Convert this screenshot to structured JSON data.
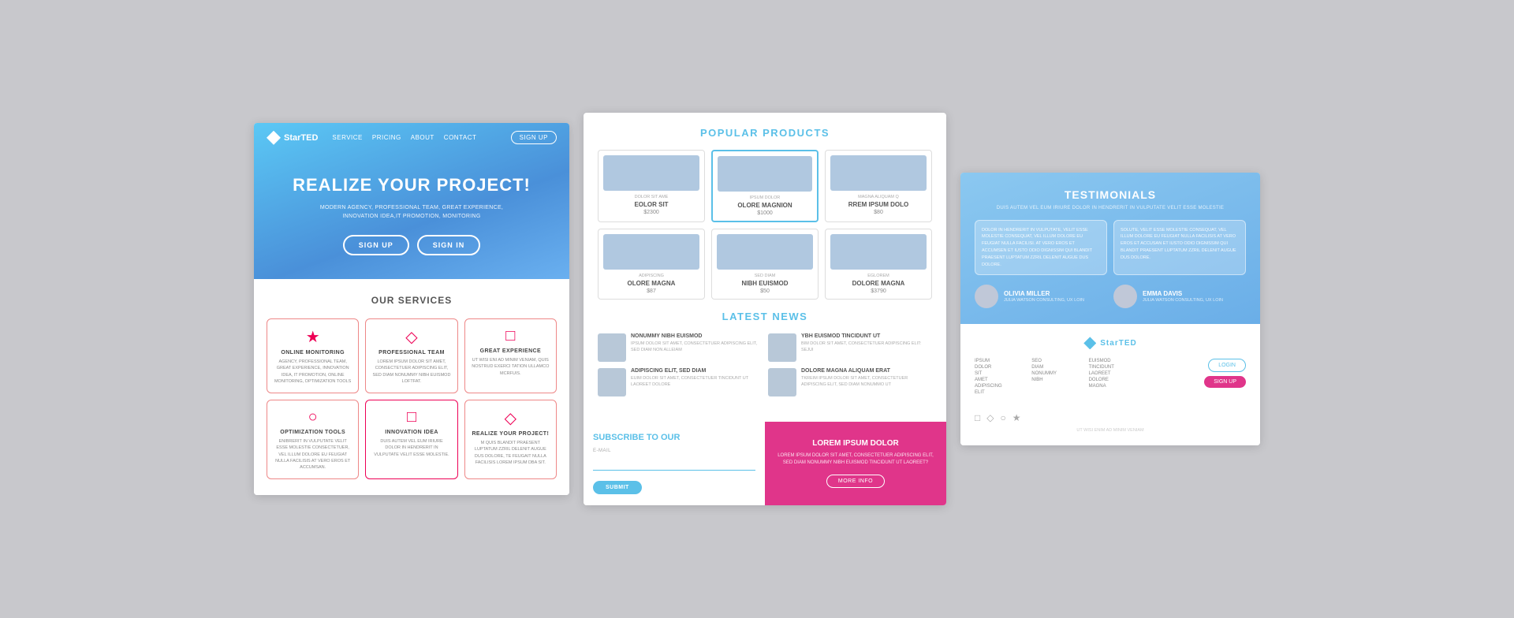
{
  "panel1": {
    "nav": {
      "logo": "StarTED",
      "links": [
        "SERVICE",
        "PRICING",
        "ABOUT",
        "CONTACT"
      ],
      "signup": "SIGN UP"
    },
    "hero": {
      "title": "REALIZE YOUR PROJECT!",
      "subtitle": "MODERN AGENCY, PROFESSIONAL TEAM, GREAT EXPERIENCE,\nINNOVATION IDEA,IT PROMOTION, MONITORING",
      "btn1": "SIGN UP",
      "btn2": "SIGN IN"
    },
    "services": {
      "title": "OUR SERVICES",
      "items": [
        {
          "icon": "★",
          "title": "ONLINE MONITORING",
          "desc": "AGENCY, PROFESSIONAL TEAM, GREAT EXPERIENCE, INNOVATION IDEA, IT PROMOTION, ONLINE MONITORING, OPTIMIZATION TOOLS"
        },
        {
          "icon": "◇",
          "title": "PROFESSIONAL TEAM",
          "desc": "LOREM IPSUM DOLOR SIT AMET, CONSECTETUER ADIPISCING ELIT, SED DIAM NONUMMY NIBH EUISMOD LOFTFAT."
        },
        {
          "icon": "□",
          "title": "GREAT EXPERIENCE",
          "desc": "UT WISI ENI AD MINIM VENIAM, QUIS NOSTRUD EXERCI TATION ULLAMCO MCRFUIS."
        },
        {
          "icon": "○",
          "title": "OPTIMIZATION TOOLS",
          "desc": "ENIBRERIT IN VULPUTATE VELIT ESSE MOLESTIE CONSECTETUER, VEL ILLUM DOLORE EU FEUGIAT NULLA FACILISIS AT VERO EROS ET ACCUMSAN."
        },
        {
          "icon": "□",
          "title": "INNOVATION IDEA",
          "desc": "DUIS AUTEM VEL EUM IRIURE DOLOR IN HENDRERIT IN VULPUTATE VELIT ESSE MOLESTIE."
        },
        {
          "icon": "◇",
          "title": "REALIZE YOUR PROJECT!",
          "desc": "M QUIS BLANDIT PRAESENT LUPTATUM ZZRIL DELENIT AUGUE DUS DOLORE, TE FEUGAIT NULLA FACILISIS LOREM IPSUM DBA SIT."
        }
      ]
    }
  },
  "panel2": {
    "products": {
      "title": "POPULAR PRODUCTS",
      "items": [
        {
          "label": "DOLOR SIT AME",
          "name": "EOLOR SIT",
          "price": "$2300",
          "featured": false
        },
        {
          "label": "IPSUM DOLOR",
          "name": "OLORE MAGNION",
          "price": "$1000",
          "featured": true
        },
        {
          "label": "MAGNA ALIQUAM Q",
          "name": "RREM IPSUM DOLO",
          "price": "$80",
          "featured": false
        },
        {
          "label": "ADIPISCING",
          "name": "OLORE MAGNA",
          "price": "$87",
          "featured": false
        },
        {
          "label": "SED DIAM",
          "name": "NIBH EUISMOD",
          "price": "$50",
          "featured": false
        },
        {
          "label": "EGLOREM",
          "name": "DOLORE MAGNA",
          "price": "$3790",
          "featured": false
        }
      ]
    },
    "news": {
      "title": "LATEST NEWS",
      "items": [
        {
          "title": "NONUMMY NIBH EUISMOD",
          "desc": "IPSUM DOLOR SIT AMET, CONSECTETUER ADIPISCING ELIT, SED DIAM NON ALLEIAM"
        },
        {
          "title": "YBH EUISMOD TINCIDUNT UT",
          "desc": "BIM DOLOR SIT AMET, CONSECTETUER ADIPISCING ELIT: SEJUI"
        },
        {
          "title": "ADIPISCING ELIT, SED DIAM",
          "desc": "EUIM DOLOR SIT AMET, CONSECTETUER TINCIDUNT UT LAOREET DOLORE"
        },
        {
          "title": "DOLORE MAGNA ALIQUAM ERAT",
          "desc": "TKREIM IPSUM DOLOR SIT AMET, CONSECTETUER ADIPISCING ELIT, SED DIAM NONUMMO UT"
        }
      ]
    },
    "subscribe": {
      "title": "SUBSCRIBE TO OUR",
      "label": "E-MAIL",
      "btn": "SUBMIT"
    },
    "cta": {
      "title": "LOREM IPSUM DOLOR",
      "desc": "LOREM IPSUM DOLOR SIT AMET, CONSECTETUER ADIPISCING ELIT, SED DIAM NONUMMY NIBH EUISMOD TINCIDUNT UT LAOREET?",
      "btn": "MORE INFO"
    }
  },
  "panel3": {
    "title": "Testimonials",
    "subtitle": "DUIS AUTEM VEL EUM IRIURE DOLOR IN HENDRERIT IN VULPUTATE VELIT ESSE MOLESTIE",
    "cards": [
      {
        "text": "DOLOR IN HENDRERIT IN VULPUTATE, VELIT ESSE MOLESTIE CONSEQUAT, VEL ILLUM DOLORE EU FEUGIAT NULLA FACILISI. AT VERO EROS ET ACCUMSEN ET IUSTO ODIO DIGNISSIM QUI BLANDIT PRAESENT LUPTATUM ZZRIL DELENIT AUGUE DUS DOLORE."
      },
      {
        "text": "SOLUTE, VELIT ESSE MOLESTIE CONSEQUAT, VEL ILLUM DOLORE EU FEUGIAT NULLA FACILISIS AT VERO EROS ET ACCUSAN ET IUSTO ODIO DIGNISSIM QUI BLANDIT PRAESENT LUPTATUM ZZRIL DELENIT AUGUE DUS DOLORE."
      }
    ],
    "authors": [
      {
        "name": "OLIVIA MILLER",
        "role": "JULIA WATSON CONSULTING, UX LOIN"
      },
      {
        "name": "EMMA DAVIS",
        "role": "JULIA WATSON CONSULTING, UX LOIN"
      }
    ],
    "footer": {
      "logo": "StarTED",
      "cols": [
        [
          "IPSUM",
          "DOLOR",
          "SIT",
          "AMET",
          "ADIPISCING",
          "ELIT"
        ],
        [
          "SEO",
          "DIAM",
          "NONUMMY",
          "NIBH"
        ],
        [
          "EUISMOD",
          "TINCIDUNT",
          "LAOREET",
          "DOLORE",
          "MAGNA"
        ],
        []
      ],
      "btn_login": "LOGIN",
      "btn_signup": "SIGN UP",
      "footer_icons": [
        "□",
        "◇",
        "○",
        "★"
      ],
      "footer_text": "UT WISI ENIM AD MINIM VENIAM"
    }
  }
}
